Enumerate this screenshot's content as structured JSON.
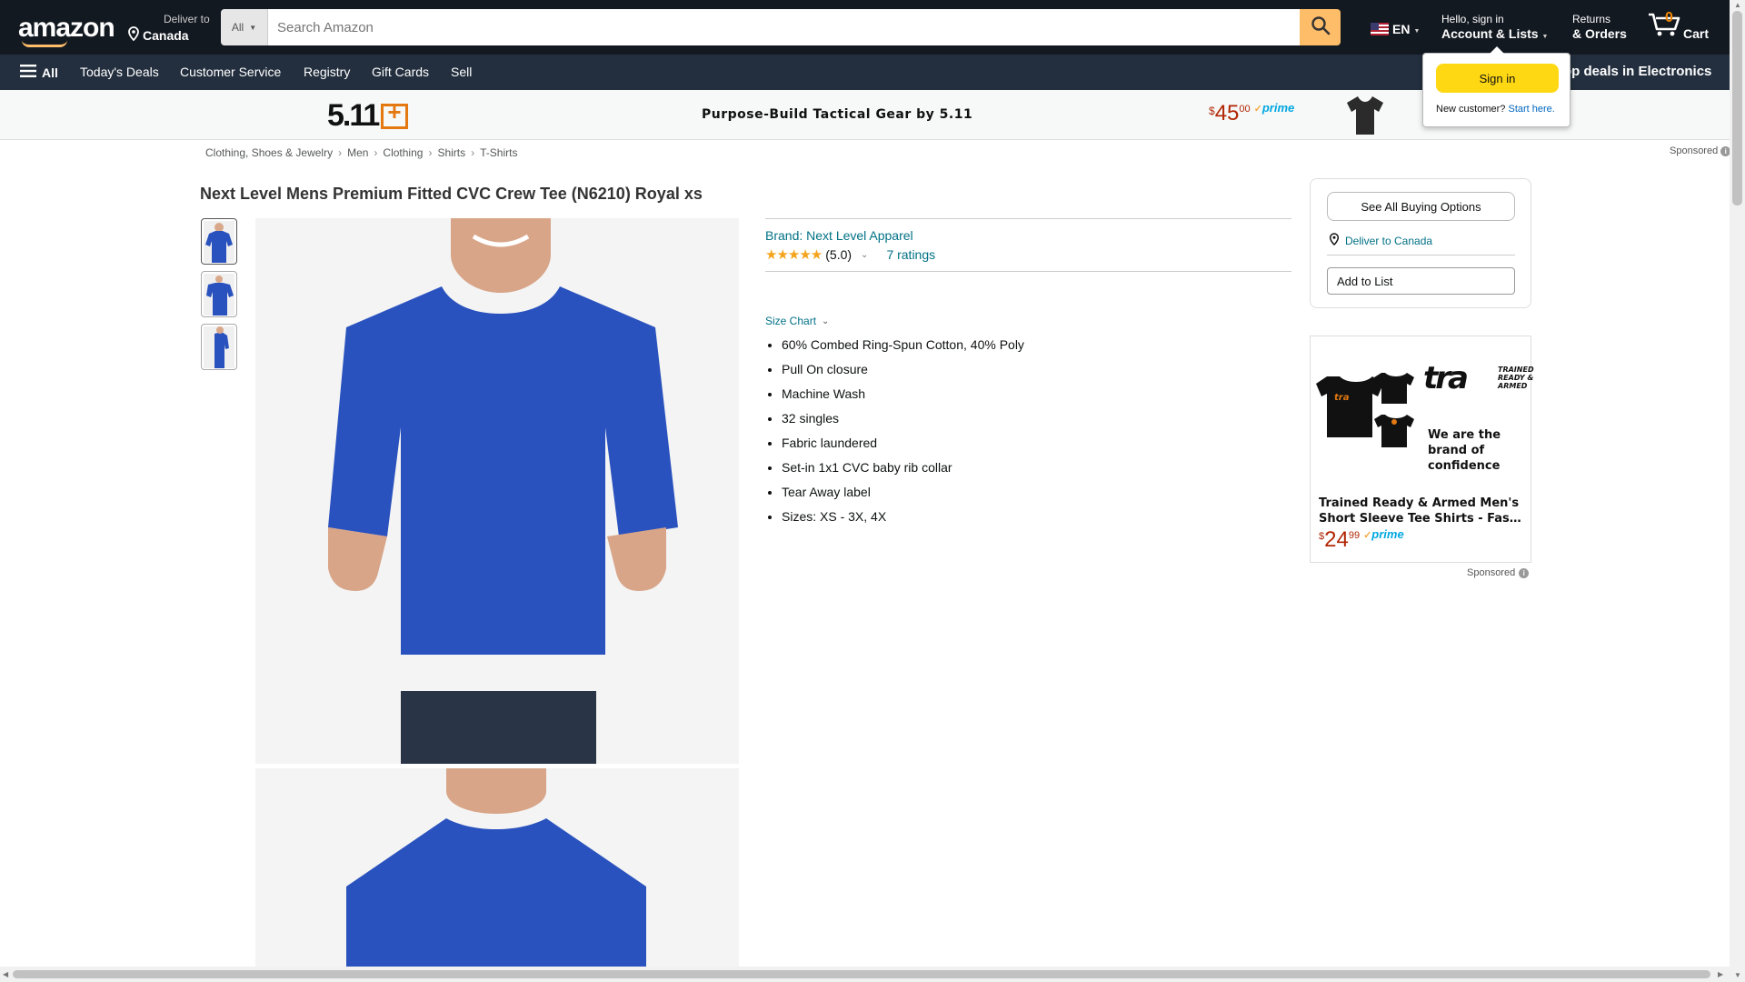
{
  "nav": {
    "logo": "amazon",
    "deliver_line1": "Deliver to",
    "deliver_line2": "Canada",
    "search_category": "All",
    "search_placeholder": "Search Amazon",
    "language": "EN",
    "account_line1": "Hello, sign in",
    "account_line2": "Account & Lists",
    "returns_line1": "Returns",
    "returns_line2": "& Orders",
    "cart_count": "0",
    "cart_label": "Cart"
  },
  "subnav": {
    "all_label": "All",
    "items": [
      "Today's Deals",
      "Customer Service",
      "Registry",
      "Gift Cards",
      "Sell"
    ],
    "promo": "op deals in Electronics"
  },
  "signin_popup": {
    "button": "Sign in",
    "new_customer": "New customer?",
    "start_here": "Start here."
  },
  "banner": {
    "brand_logo": "5.11",
    "title": "Purpose-Build Tactical Gear by 5.11",
    "price_currency": "$",
    "price_whole": "45",
    "price_cents": "00",
    "prime": "prime"
  },
  "breadcrumbs": [
    "Clothing, Shoes & Jewelry",
    "Men",
    "Clothing",
    "Shirts",
    "T-Shirts"
  ],
  "sponsored_label": "Sponsored",
  "product": {
    "title": "Next Level Mens Premium Fitted CVC Crew Tee (N6210) Royal xs",
    "brand": "Brand: Next Level Apparel",
    "rating_value": "(5.0)",
    "ratings_count": "7 ratings",
    "size_chart": "Size Chart",
    "bullets": [
      "60% Combed Ring-Spun Cotton, 40% Poly",
      "Pull On closure",
      "Machine Wash",
      "32 singles",
      "Fabric laundered",
      "Set-in 1x1 CVC baby rib collar",
      "Tear Away label",
      "Sizes: XS - 3X, 4X"
    ],
    "shirt_color": "#2a52be"
  },
  "buybox": {
    "see_all": "See All Buying Options",
    "deliver": "Deliver to Canada",
    "add_to_list": "Add to List"
  },
  "ad": {
    "logo": "tra",
    "logo_sub": "TRAINED READY & ARMED",
    "tagline": "We are the brand of confidence",
    "name_line1": "Trained Ready & Armed Men's",
    "name_line2": "Short Sleeve Tee Shirts - Fashio...",
    "price_currency": "$",
    "price_whole": "24",
    "price_cents": "99",
    "prime": "prime",
    "sponsored": "Sponsored"
  },
  "colors": {
    "nav_bg": "#131921",
    "subnav_bg": "#232f3e",
    "search_button": "#febd69",
    "signin_button": "#ffd814",
    "link": "#007185",
    "price": "#b12704"
  }
}
